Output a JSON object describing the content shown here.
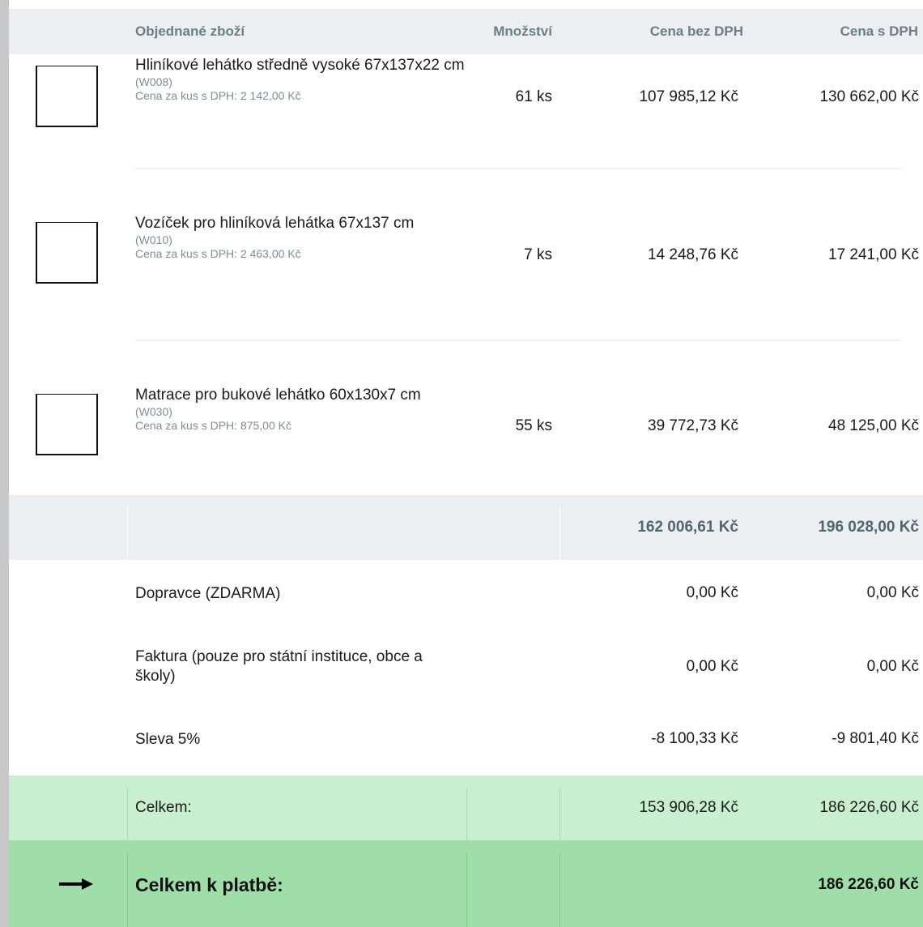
{
  "header": {
    "item": "Objednané zboží",
    "quantity": "Množství",
    "price_net": "Cena bez DPH",
    "price_gross": "Cena s DPH"
  },
  "products": [
    {
      "name": "Hliníkové lehátko středně vysoké 67x137x22 cm",
      "code": "(W008)",
      "unit_price": "Cena za kus s DPH: 2 142,00 Kč",
      "quantity": "61 ks",
      "price_net": "107 985,12 Kč",
      "price_gross": "130 662,00 Kč"
    },
    {
      "name": "Vozíček pro hliníková lehátka 67x137 cm",
      "code": "(W010)",
      "unit_price": "Cena za kus s DPH: 2 463,00 Kč",
      "quantity": "7 ks",
      "price_net": "14 248,76 Kč",
      "price_gross": "17 241,00 Kč"
    },
    {
      "name": "Matrace pro bukové lehátko 60x130x7 cm",
      "code": "(W030)",
      "unit_price": "Cena za kus s DPH: 875,00 Kč",
      "quantity": "55 ks",
      "price_net": "39 772,73 Kč",
      "price_gross": "48 125,00 Kč"
    }
  ],
  "subtotal": {
    "price_net": "162 006,61 Kč",
    "price_gross": "196 028,00 Kč"
  },
  "fees": [
    {
      "label": "Dopravce (ZDARMA)",
      "price_net": "0,00 Kč",
      "price_gross": "0,00 Kč"
    },
    {
      "label": "Faktura (pouze pro státní instituce, obce a školy)",
      "price_net": "0,00 Kč",
      "price_gross": "0,00 Kč"
    },
    {
      "label": "Sleva 5%",
      "price_net": "-8 100,33 Kč",
      "price_gross": "-9 801,40 Kč"
    }
  ],
  "total": {
    "label": "Celkem:",
    "price_net": "153 906,28 Kč",
    "price_gross": "186 226,60 Kč"
  },
  "payable": {
    "label": "Celkem k platbě:",
    "price_gross": "186 226,60 Kč",
    "arrow_icon": "arrow-right-icon"
  },
  "colors": {
    "header_bg": "#eceff1",
    "header_text": "#6b7f88",
    "total_bg": "#c8efcf",
    "payable_bg": "#9fdea8"
  }
}
